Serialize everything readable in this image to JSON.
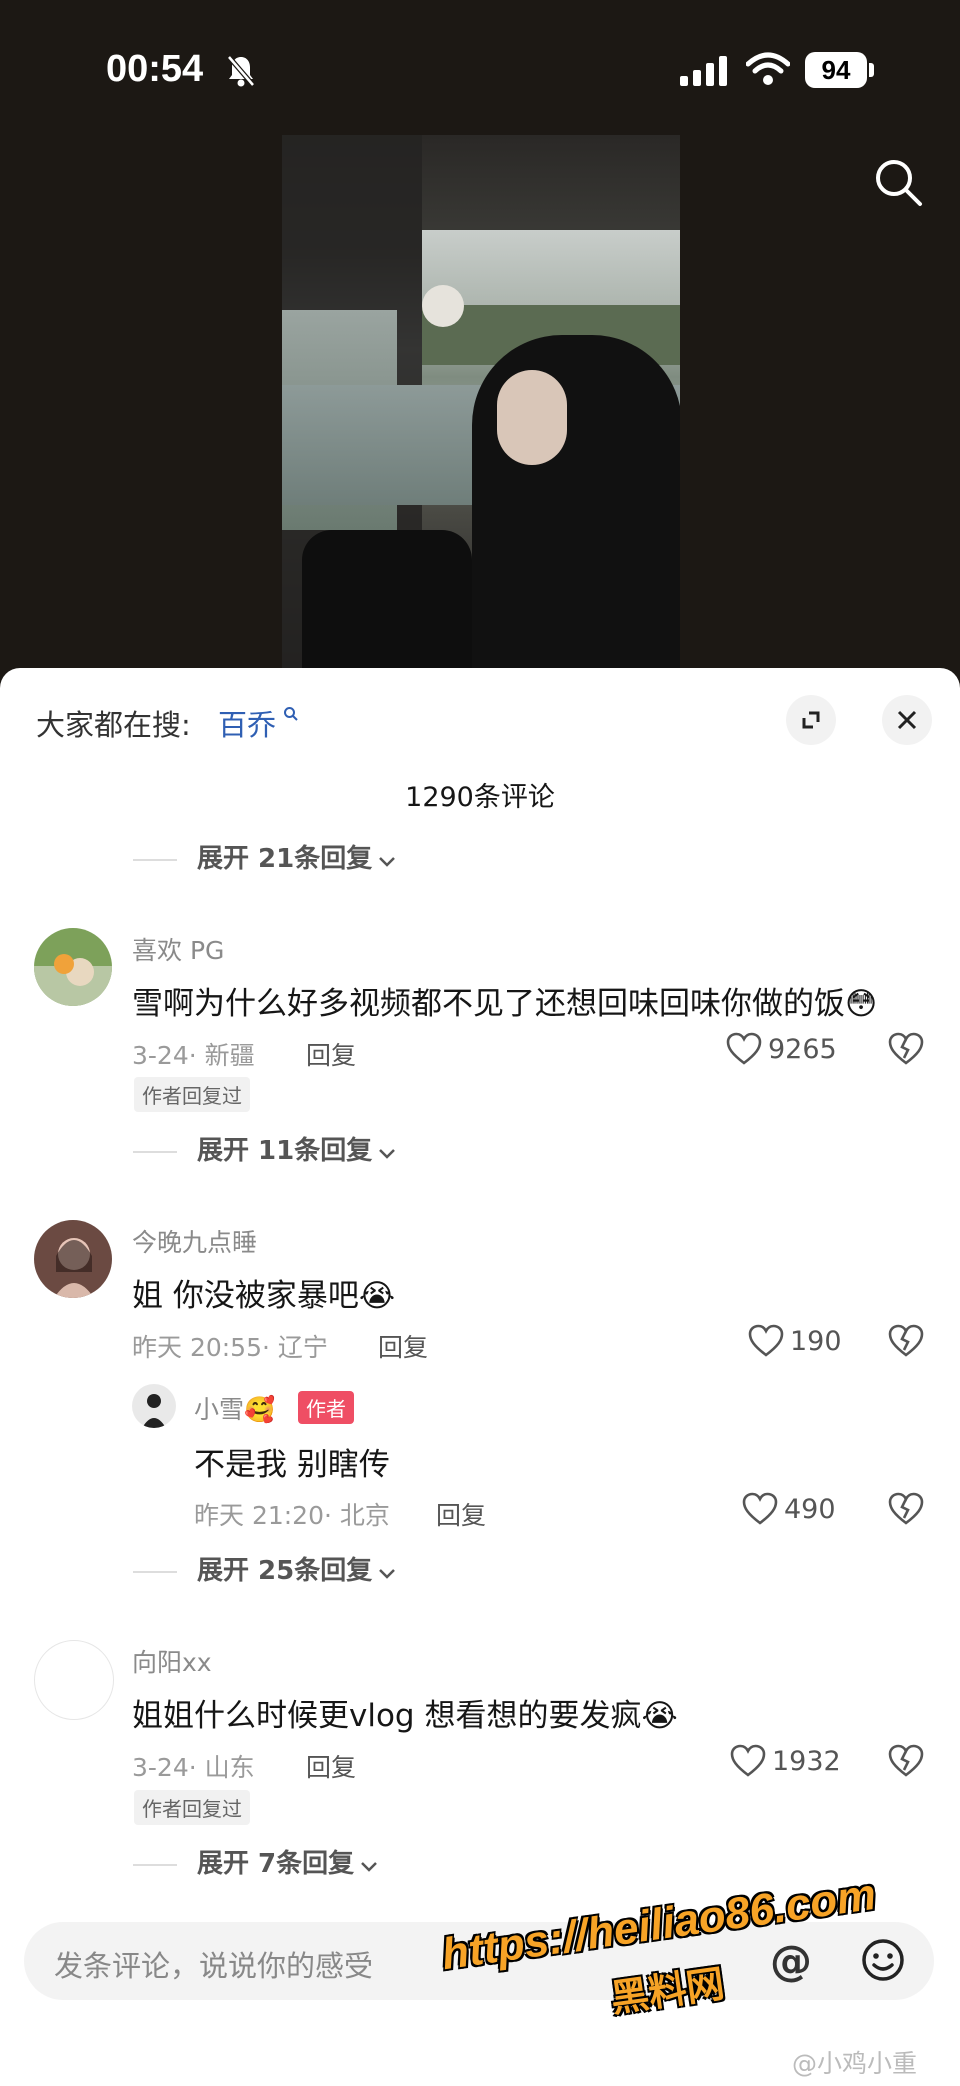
{
  "status_bar": {
    "time": "00:54",
    "battery": "94"
  },
  "video": {},
  "search_hint": {
    "label": "大家都在搜:",
    "term": "百乔"
  },
  "comment_count": "1290条评论",
  "expand_rows": [
    "展开 21条回复",
    "展开 11条回复",
    "展开 25条回复",
    "展开 7条回复"
  ],
  "comments": [
    {
      "username": "喜欢 PG",
      "content": "雪啊为什么好多视频都不见了还想回味回味你做的饭😳",
      "meta": "3-24· 新疆",
      "reply": "回复",
      "likes": "9265",
      "badge": "作者回复过"
    },
    {
      "username": "今晚九点睡",
      "content": "姐 你没被家暴吧😭",
      "meta": "昨天 20:55· 辽宁",
      "reply": "回复",
      "likes": "190"
    },
    {
      "username": "小雪🥰",
      "author_badge": "作者",
      "content": "不是我 别瞎传",
      "meta": "昨天 21:20· 北京",
      "reply": "回复",
      "likes": "490"
    },
    {
      "username": "向阳xx",
      "content": "姐姐什么时候更vlog  想看想的要发疯😭",
      "meta": "3-24· 山东",
      "reply": "回复",
      "likes": "1932",
      "badge": "作者回复过"
    }
  ],
  "input": {
    "placeholder": "发条评论，说说你的感受"
  },
  "watermark": {
    "url": "https://heiliao86.com",
    "name": "黑料网",
    "weibo": "@小鸡小重"
  },
  "colors": {
    "accent_blue": "#2f5fb3",
    "author_red": "#ef4e64",
    "watermark_orange": "#f7a326"
  }
}
